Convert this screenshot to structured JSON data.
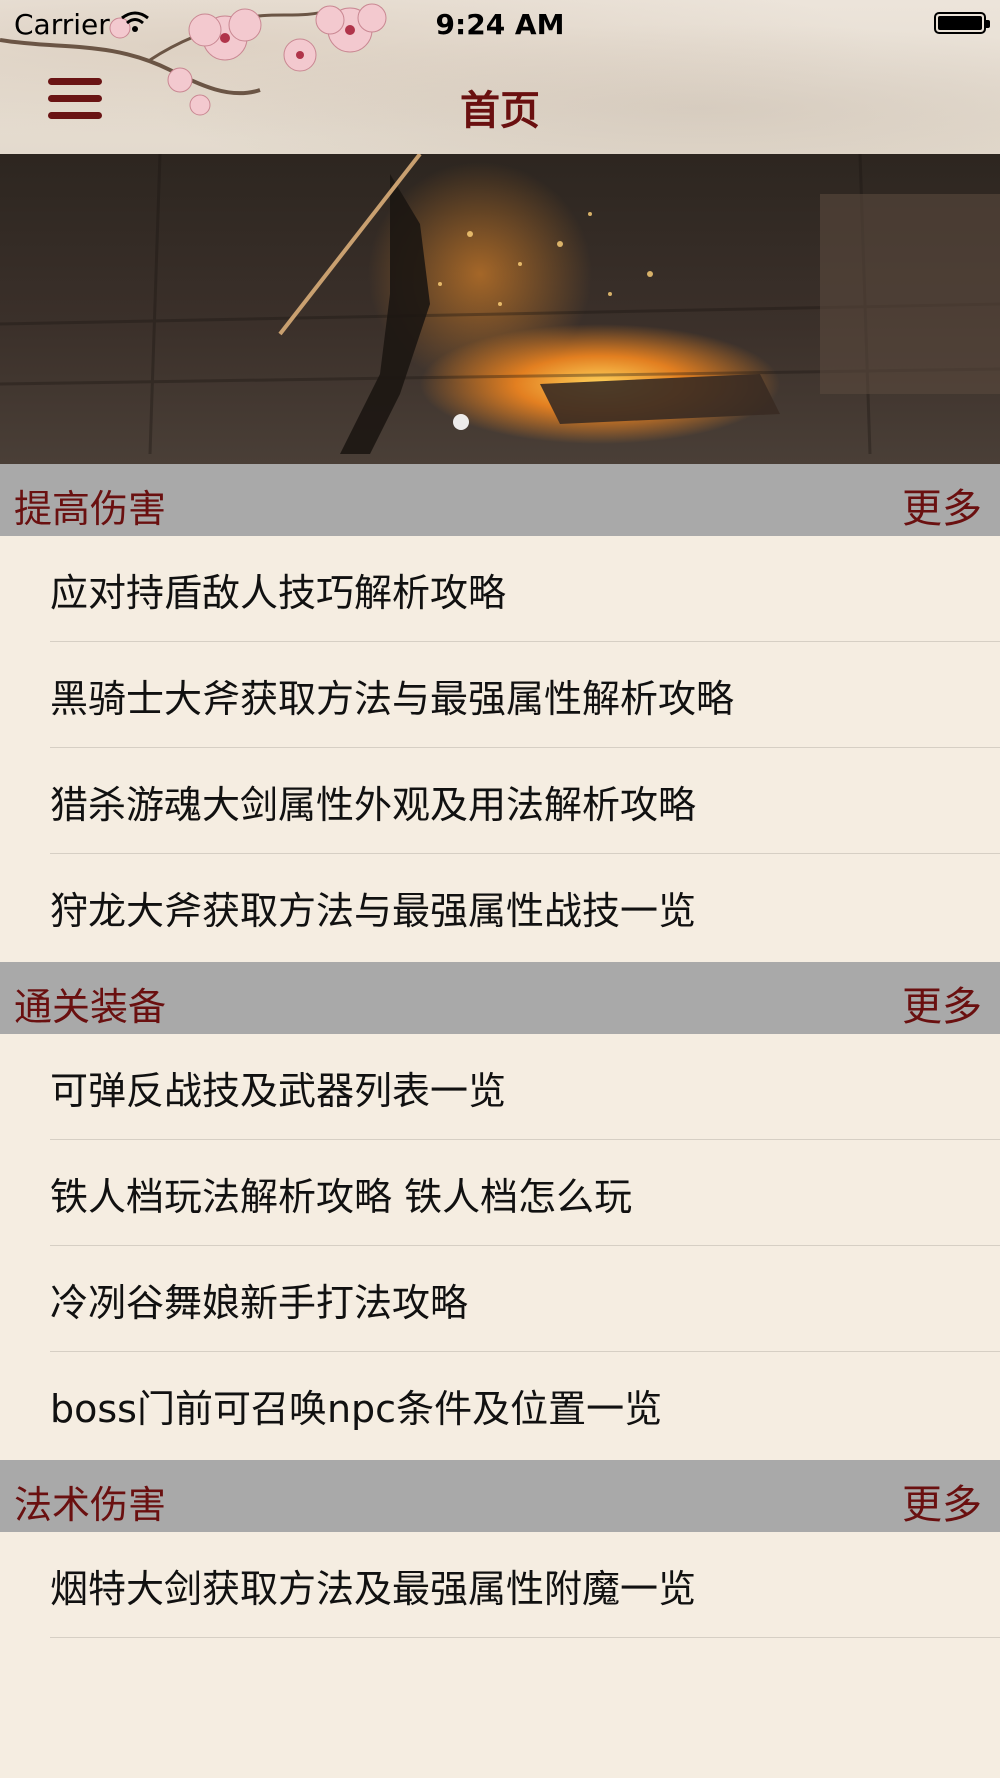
{
  "status_bar": {
    "carrier": "Carrier",
    "time": "9:24 AM"
  },
  "nav": {
    "title": "首页",
    "menu_icon": "hamburger-menu-icon"
  },
  "banner": {
    "page_count_active": 1
  },
  "colors": {
    "accent": "#6a1010",
    "section_bg": "#a9a9a9",
    "page_bg": "#f5ede1"
  },
  "sections": [
    {
      "title": "提高伤害",
      "more_label": "更多",
      "items": [
        "应对持盾敌人技巧解析攻略",
        "黑骑士大斧获取方法与最强属性解析攻略",
        "猎杀游魂大剑属性外观及用法解析攻略",
        "狩龙大斧获取方法与最强属性战技一览"
      ]
    },
    {
      "title": "通关装备",
      "more_label": "更多",
      "items": [
        "可弹反战技及武器列表一览",
        "铁人档玩法解析攻略 铁人档怎么玩",
        "冷冽谷舞娘新手打法攻略",
        "boss门前可召唤npc条件及位置一览"
      ]
    },
    {
      "title": "法术伤害",
      "more_label": "更多",
      "items": [
        "烟特大剑获取方法及最强属性附魔一览"
      ]
    }
  ]
}
